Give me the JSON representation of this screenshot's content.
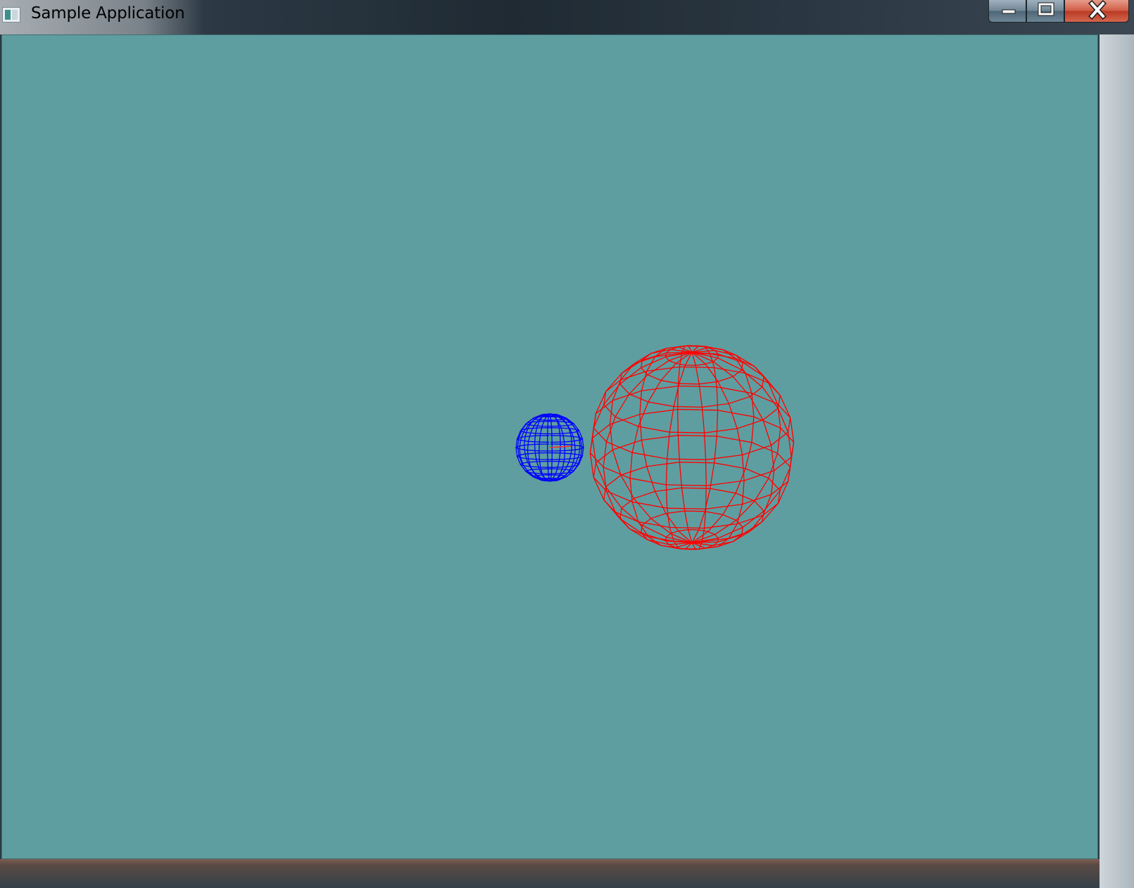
{
  "window": {
    "title": "Sample Application",
    "icon": "app-window-icon",
    "controls": [
      "minimize-icon",
      "maximize-icon",
      "close-icon"
    ]
  },
  "scene": {
    "background_color": "#5f9ea0",
    "objects": [
      {
        "name": "large-wireframe-sphere",
        "color": "#ff0000"
      },
      {
        "name": "small-wireframe-sphere",
        "color": "#0000ff"
      }
    ]
  }
}
